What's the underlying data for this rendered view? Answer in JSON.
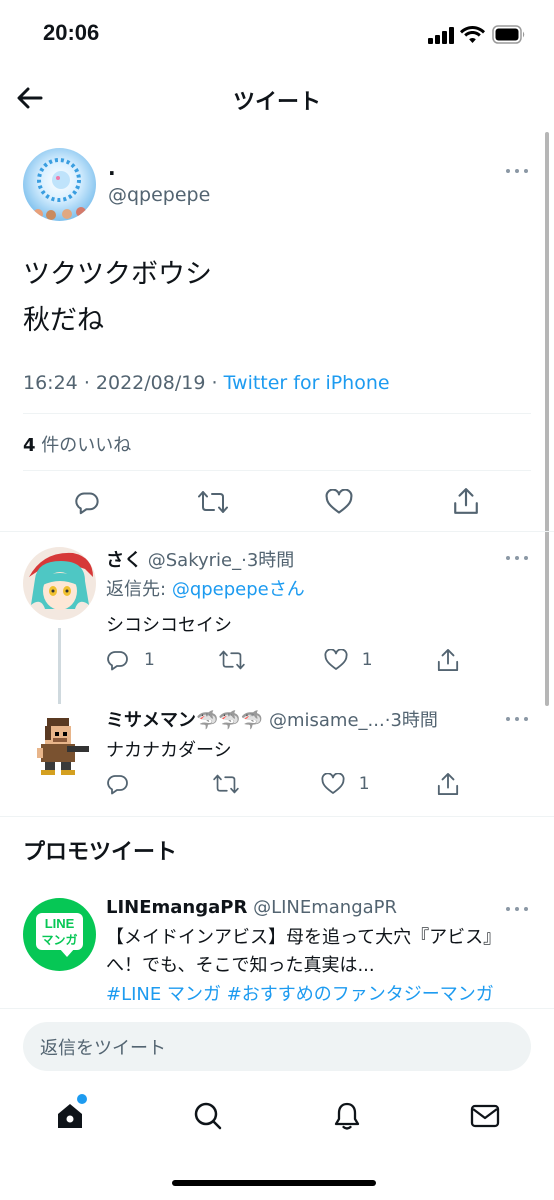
{
  "status_bar": {
    "time": "20:06"
  },
  "header": {
    "title": "ツイート"
  },
  "tweet": {
    "display_name": ".",
    "handle": "@qpepepe",
    "lines": [
      "ツクツクボウシ",
      "秋だね"
    ],
    "time": "16:24",
    "date": "2022/08/19",
    "separator": "·",
    "source": "Twitter for iPhone",
    "likes_count": "4",
    "likes_label": "件のいいね"
  },
  "replies": [
    {
      "display_name": "さく",
      "handle": "@Sakyrie_",
      "time": "3時間",
      "reply_to_label": "返信先:",
      "reply_to_handle": "@qpepepe",
      "reply_to_suffix": "さん",
      "text": "シコシコセイシ",
      "reply_count": "1",
      "like_count": "1"
    },
    {
      "display_name": "ミサメマン🦈🦈🦈",
      "handle": "@misame_...",
      "time": "3時間",
      "text": "ナカナカダーシ",
      "like_count": "1"
    }
  ],
  "promo": {
    "section_title": "プロモツイート",
    "display_name": "LINEmangaPR",
    "handle": "@LINEmangaPR",
    "text": "【メイドインアビス】母を追って大穴『アビス』へ！でも、そこで知った真実は...",
    "hashtags": "#LINE マンガ #おすすめのファンタジーマンガ",
    "logo_line1": "LINE",
    "logo_line2": "マンガ"
  },
  "composer": {
    "placeholder": "返信をツイート"
  },
  "colors": {
    "accent": "#1d9bf0",
    "text": "#0f1419",
    "muted": "#536471",
    "line_green": "#06c755"
  }
}
